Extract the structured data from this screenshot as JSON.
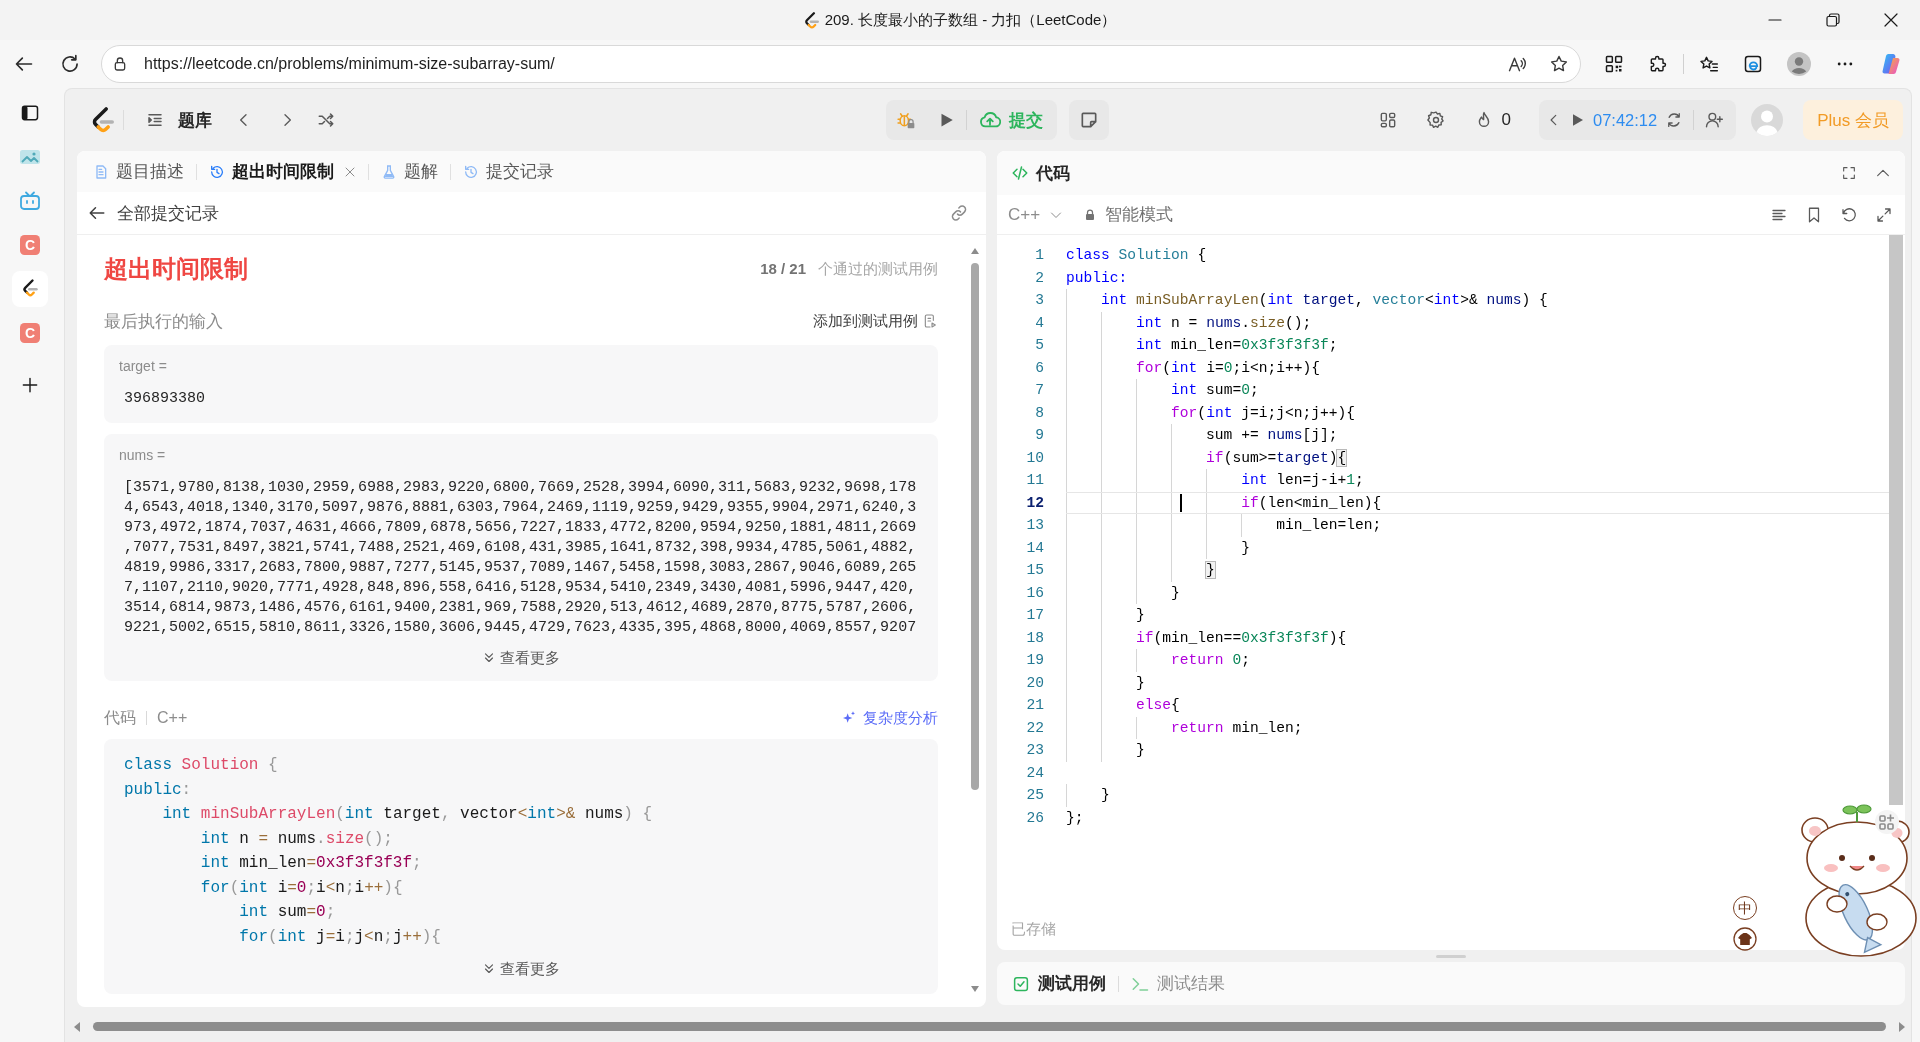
{
  "window": {
    "title": "209. 长度最小的子数组 - 力扣（LeetCode）"
  },
  "browser": {
    "url": "https://leetcode.cn/problems/minimum-size-subarray-sum/",
    "sidebar": [
      {
        "kind": "image",
        "selected": false
      },
      {
        "kind": "tv",
        "selected": false
      },
      {
        "kind": "letter",
        "text": "C",
        "selected": false
      },
      {
        "kind": "leetcode",
        "selected": true
      },
      {
        "kind": "letter",
        "text": "C",
        "selected": false
      }
    ]
  },
  "nav": {
    "problem_list": "题库",
    "submit": "提交",
    "streak": "0",
    "timer": "07:42:12",
    "plus": "Plus 会员"
  },
  "left_panel": {
    "tabs": [
      {
        "label": "题目描述",
        "kind": "description",
        "selected": false,
        "closable": false
      },
      {
        "label": "超出时间限制",
        "kind": "history",
        "selected": true,
        "closable": true
      },
      {
        "label": "题解",
        "kind": "solution",
        "selected": false,
        "closable": false
      },
      {
        "label": "提交记录",
        "kind": "history",
        "selected": false,
        "closable": false
      }
    ],
    "back_link": "全部提交记录",
    "result": {
      "status": "超出时间限制",
      "passed": "18 / 21",
      "passed_label": "个通过的测试用例"
    },
    "last_input": {
      "label": "最后执行的输入",
      "add_button": "添加到测试用例",
      "inputs": [
        {
          "name": "target =",
          "value": "396893380"
        },
        {
          "name": "nums =",
          "value": "[3571,9780,8138,1030,2959,6988,2983,9220,6800,7669,2528,3994,6090,311,5683,9232,9698,1784,6543,4018,1340,3170,5097,9876,8881,6303,7964,2469,1119,9259,9429,9355,9904,2971,6240,3973,4972,1874,7037,4631,4666,7809,6878,5656,7227,1833,4772,8200,9594,9250,1881,4811,2669,7077,7531,8497,3821,5741,7488,2521,469,6108,431,3985,1641,8732,398,9934,4785,5061,4882,4819,9986,3317,2683,7800,9887,7277,5145,9537,7089,1467,5458,1598,3083,2867,9046,6089,2657,1107,2110,9020,7771,4928,848,896,558,6416,5128,9534,5410,2349,3430,4081,5996,9447,420,3514,6814,9873,1486,4576,6161,9400,2381,969,7588,2920,513,4612,4689,2870,8775,5787,2606,9221,5002,6515,5810,8611,3326,1580,3606,9445,4729,7623,4335,395,4868,8000,4069,8557,9207",
          "show_more": "查看更多"
        }
      ]
    },
    "code": {
      "label": "代码",
      "language": "C++",
      "analysis_button": "复杂度分析",
      "lines": [
        [
          {
            "text": "class",
            "kind": "kw"
          },
          {
            "text": " Solution",
            "kind": "cls"
          },
          {
            "text": " {",
            "kind": "p"
          }
        ],
        [
          {
            "text": "public",
            "kind": "kw"
          },
          {
            "text": ":",
            "kind": "p"
          }
        ],
        [
          {
            "text": "    int",
            "kind": "kw"
          },
          {
            "text": " minSubArrayLen",
            "kind": "fn"
          },
          {
            "text": "(",
            "kind": "p"
          },
          {
            "text": "int",
            "kind": "kw"
          },
          {
            "text": " target",
            "kind": "id"
          },
          {
            "text": ", ",
            "kind": "p"
          },
          {
            "text": "vector",
            "kind": "id"
          },
          {
            "text": "<",
            "kind": "op"
          },
          {
            "text": "int",
            "kind": "kw"
          },
          {
            "text": ">&",
            "kind": "op"
          },
          {
            "text": " nums",
            "kind": "id"
          },
          {
            "text": ")",
            "kind": "p"
          },
          {
            "text": " {",
            "kind": "p"
          }
        ],
        [
          {
            "text": "        int",
            "kind": "kw"
          },
          {
            "text": " n ",
            "kind": "id"
          },
          {
            "text": "=",
            "kind": "op"
          },
          {
            "text": " nums",
            "kind": "id"
          },
          {
            "text": ".",
            "kind": "p"
          },
          {
            "text": "size",
            "kind": "fn"
          },
          {
            "text": "();",
            "kind": "p"
          }
        ],
        [
          {
            "text": "        int",
            "kind": "kw"
          },
          {
            "text": " min_len",
            "kind": "id"
          },
          {
            "text": "=",
            "kind": "op"
          },
          {
            "text": "0x3f3f3f3f",
            "kind": "num"
          },
          {
            "text": ";",
            "kind": "p"
          }
        ],
        [
          {
            "text": "        for",
            "kind": "kw"
          },
          {
            "text": "(",
            "kind": "p"
          },
          {
            "text": "int",
            "kind": "kw"
          },
          {
            "text": " i",
            "kind": "id"
          },
          {
            "text": "=",
            "kind": "op"
          },
          {
            "text": "0",
            "kind": "num"
          },
          {
            "text": ";",
            "kind": "p"
          },
          {
            "text": "i",
            "kind": "id"
          },
          {
            "text": "<",
            "kind": "op"
          },
          {
            "text": "n",
            "kind": "id"
          },
          {
            "text": ";",
            "kind": "p"
          },
          {
            "text": "i",
            "kind": "id"
          },
          {
            "text": "++",
            "kind": "op"
          },
          {
            "text": "){",
            "kind": "p"
          }
        ],
        [
          {
            "text": "            int",
            "kind": "kw"
          },
          {
            "text": " sum",
            "kind": "id"
          },
          {
            "text": "=",
            "kind": "op"
          },
          {
            "text": "0",
            "kind": "num"
          },
          {
            "text": ";",
            "kind": "p"
          }
        ],
        [
          {
            "text": "            for",
            "kind": "kw"
          },
          {
            "text": "(",
            "kind": "p"
          },
          {
            "text": "int",
            "kind": "kw"
          },
          {
            "text": " j",
            "kind": "id"
          },
          {
            "text": "=",
            "kind": "op"
          },
          {
            "text": "i",
            "kind": "id"
          },
          {
            "text": ";",
            "kind": "p"
          },
          {
            "text": "j",
            "kind": "id"
          },
          {
            "text": "<",
            "kind": "op"
          },
          {
            "text": "n",
            "kind": "id"
          },
          {
            "text": ";",
            "kind": "p"
          },
          {
            "text": "j",
            "kind": "id"
          },
          {
            "text": "++",
            "kind": "op"
          },
          {
            "text": "){",
            "kind": "p"
          }
        ]
      ],
      "show_more": "查看更多"
    }
  },
  "editor": {
    "title": "代码",
    "language": "C++",
    "mode": "智能模式",
    "lines": [
      {
        "number": "1",
        "current": false,
        "code": [
          {
            "text": "class",
            "kind": "kw"
          },
          {
            "text": " Solution",
            "kind": "type"
          },
          {
            "text": " {",
            "kind": "id"
          }
        ]
      },
      {
        "number": "2",
        "current": false,
        "code": [
          {
            "text": "public:",
            "kind": "kw"
          }
        ]
      },
      {
        "number": "3",
        "current": false,
        "code": [
          {
            "text": "    int",
            "kind": "kw"
          },
          {
            "text": " minSubArrayLen",
            "kind": "fn"
          },
          {
            "text": "(",
            "kind": "id"
          },
          {
            "text": "int",
            "kind": "kw"
          },
          {
            "text": " target",
            "kind": "param"
          },
          {
            "text": ", ",
            "kind": "id"
          },
          {
            "text": "vector",
            "kind": "type"
          },
          {
            "text": "<",
            "kind": "id"
          },
          {
            "text": "int",
            "kind": "kw"
          },
          {
            "text": ">& ",
            "kind": "id"
          },
          {
            "text": "nums",
            "kind": "param"
          },
          {
            "text": ") {",
            "kind": "id"
          }
        ]
      },
      {
        "number": "4",
        "current": false,
        "code": [
          {
            "text": "        int",
            "kind": "kw"
          },
          {
            "text": " n = ",
            "kind": "id"
          },
          {
            "text": "nums",
            "kind": "param"
          },
          {
            "text": ".",
            "kind": "id"
          },
          {
            "text": "size",
            "kind": "fn"
          },
          {
            "text": "();",
            "kind": "id"
          }
        ]
      },
      {
        "number": "5",
        "current": false,
        "code": [
          {
            "text": "        int",
            "kind": "kw"
          },
          {
            "text": " min_len=",
            "kind": "id"
          },
          {
            "text": "0x3f3f3f3f",
            "kind": "num"
          },
          {
            "text": ";",
            "kind": "id"
          }
        ]
      },
      {
        "number": "6",
        "current": false,
        "code": [
          {
            "text": "        for",
            "kind": "ctl"
          },
          {
            "text": "(",
            "kind": "id"
          },
          {
            "text": "int",
            "kind": "kw"
          },
          {
            "text": " i=",
            "kind": "id"
          },
          {
            "text": "0",
            "kind": "num"
          },
          {
            "text": ";i<n;i++){",
            "kind": "id"
          }
        ]
      },
      {
        "number": "7",
        "current": false,
        "code": [
          {
            "text": "            int",
            "kind": "kw"
          },
          {
            "text": " sum=",
            "kind": "id"
          },
          {
            "text": "0",
            "kind": "num"
          },
          {
            "text": ";",
            "kind": "id"
          }
        ]
      },
      {
        "number": "8",
        "current": false,
        "code": [
          {
            "text": "            for",
            "kind": "ctl"
          },
          {
            "text": "(",
            "kind": "id"
          },
          {
            "text": "int",
            "kind": "kw"
          },
          {
            "text": " j=i;j<n;j++){",
            "kind": "id"
          }
        ]
      },
      {
        "number": "9",
        "current": false,
        "code": [
          {
            "text": "                sum += ",
            "kind": "id"
          },
          {
            "text": "nums",
            "kind": "param"
          },
          {
            "text": "[j];",
            "kind": "id"
          }
        ]
      },
      {
        "number": "10",
        "current": false,
        "code": [
          {
            "text": "                if",
            "kind": "ctl"
          },
          {
            "text": "(sum>=",
            "kind": "id"
          },
          {
            "text": "target",
            "kind": "param"
          },
          {
            "text": ")",
            "kind": "id"
          },
          {
            "text": "{",
            "kind": "match"
          }
        ]
      },
      {
        "number": "11",
        "current": false,
        "code": [
          {
            "text": "                    int",
            "kind": "kw"
          },
          {
            "text": " len=j-i+",
            "kind": "id"
          },
          {
            "text": "1",
            "kind": "num"
          },
          {
            "text": ";",
            "kind": "id"
          }
        ]
      },
      {
        "number": "12",
        "current": true,
        "code": [
          {
            "text": "                    if",
            "kind": "ctl"
          },
          {
            "text": "(len<min_len){",
            "kind": "id"
          }
        ]
      },
      {
        "number": "13",
        "current": false,
        "code": [
          {
            "text": "                        min_len=len;",
            "kind": "id"
          }
        ]
      },
      {
        "number": "14",
        "current": false,
        "code": [
          {
            "text": "                    }",
            "kind": "id"
          }
        ]
      },
      {
        "number": "15",
        "current": false,
        "code": [
          {
            "text": "                }",
            "kind": "match"
          }
        ]
      },
      {
        "number": "16",
        "current": false,
        "code": [
          {
            "text": "            }",
            "kind": "id"
          }
        ]
      },
      {
        "number": "17",
        "current": false,
        "code": [
          {
            "text": "        }",
            "kind": "id"
          }
        ]
      },
      {
        "number": "18",
        "current": false,
        "code": [
          {
            "text": "        if",
            "kind": "ctl"
          },
          {
            "text": "(min_len==",
            "kind": "id"
          },
          {
            "text": "0x3f3f3f3f",
            "kind": "num"
          },
          {
            "text": "){",
            "kind": "id"
          }
        ]
      },
      {
        "number": "19",
        "current": false,
        "code": [
          {
            "text": "            return",
            "kind": "ctl"
          },
          {
            "text": " 0",
            "kind": "num"
          },
          {
            "text": ";",
            "kind": "id"
          }
        ]
      },
      {
        "number": "20",
        "current": false,
        "code": [
          {
            "text": "        }",
            "kind": "id"
          }
        ]
      },
      {
        "number": "21",
        "current": false,
        "code": [
          {
            "text": "        else",
            "kind": "ctl"
          },
          {
            "text": "{",
            "kind": "id"
          }
        ]
      },
      {
        "number": "22",
        "current": false,
        "code": [
          {
            "text": "            return",
            "kind": "ctl"
          },
          {
            "text": " min_len;",
            "kind": "id"
          }
        ]
      },
      {
        "number": "23",
        "current": false,
        "code": [
          {
            "text": "        }",
            "kind": "id"
          }
        ]
      },
      {
        "number": "24",
        "current": false
      },
      {
        "number": "25",
        "current": false,
        "code": [
          {
            "text": "    }",
            "kind": "id"
          }
        ]
      },
      {
        "number": "26",
        "current": false,
        "code": [
          {
            "text": "};",
            "kind": "id"
          }
        ]
      }
    ],
    "status": "已存储"
  },
  "test_panel": {
    "tabs": [
      {
        "label": "测试用例",
        "kind": "testcase",
        "selected": true
      },
      {
        "label": "测试结果",
        "kind": "result",
        "selected": false
      }
    ]
  },
  "ime": {
    "mode": "中"
  }
}
